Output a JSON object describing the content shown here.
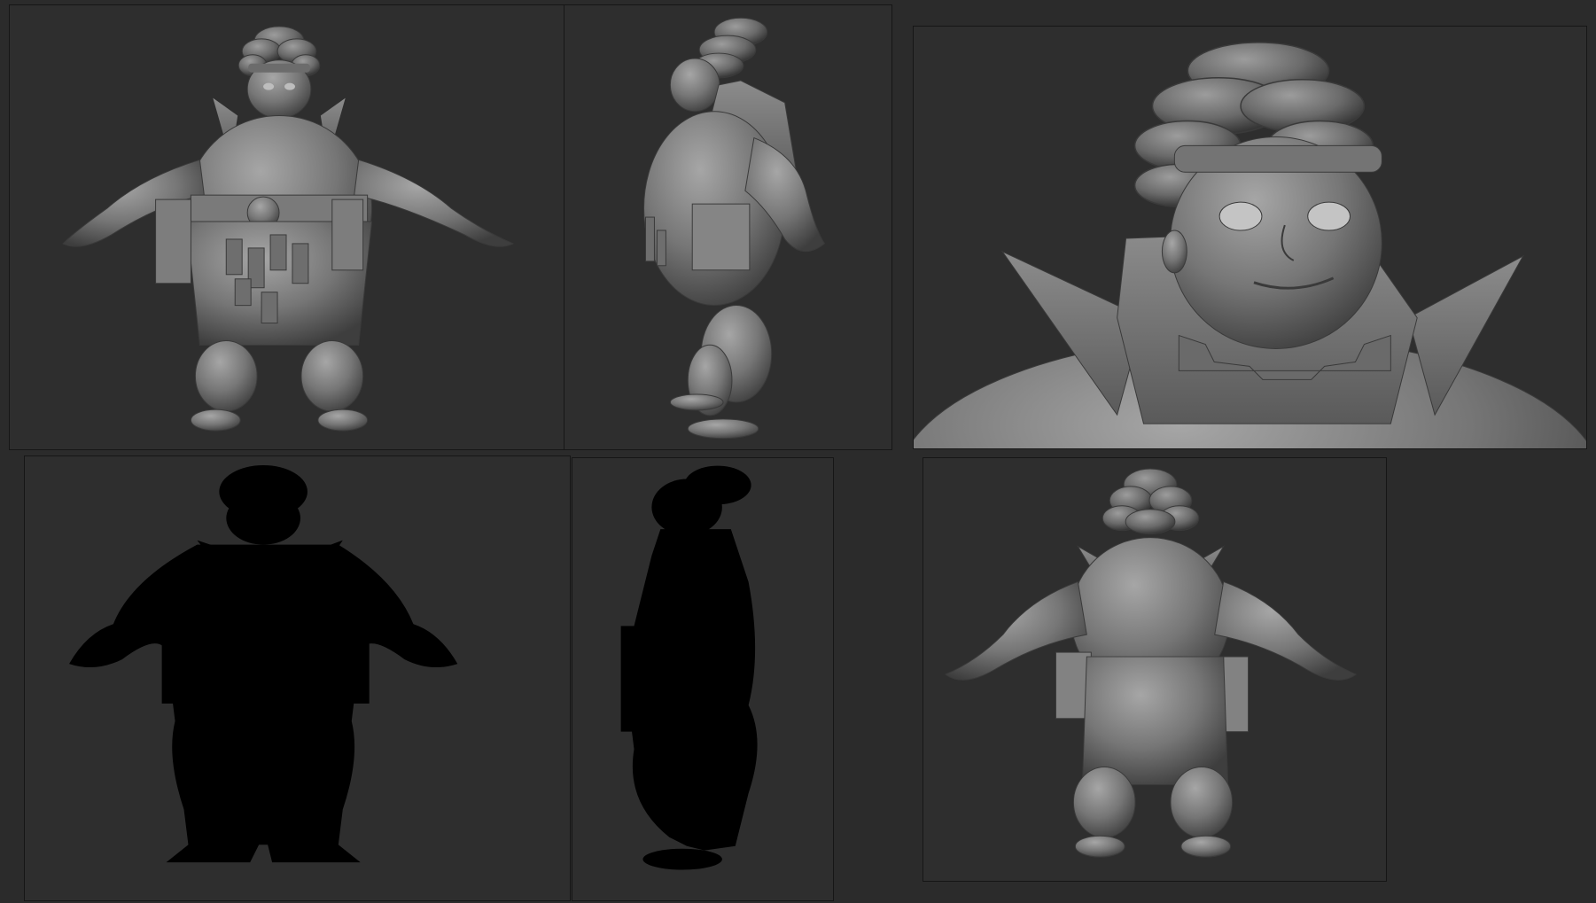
{
  "sheet": {
    "background": "#2b2b2b",
    "panel_background": "#2e2e2e",
    "panel_border": "#161616",
    "sculpt_light": "#9a9a9a",
    "sculpt_mid": "#6f6f6f",
    "sculpt_dark": "#3c3c3c",
    "silhouette": "#000000"
  },
  "panels": [
    {
      "view": "front",
      "style": "clay-render"
    },
    {
      "view": "side",
      "style": "clay-render"
    },
    {
      "view": "face-closeup",
      "style": "clay-render"
    },
    {
      "view": "front",
      "style": "silhouette"
    },
    {
      "view": "side",
      "style": "silhouette"
    },
    {
      "view": "back",
      "style": "clay-render"
    }
  ]
}
